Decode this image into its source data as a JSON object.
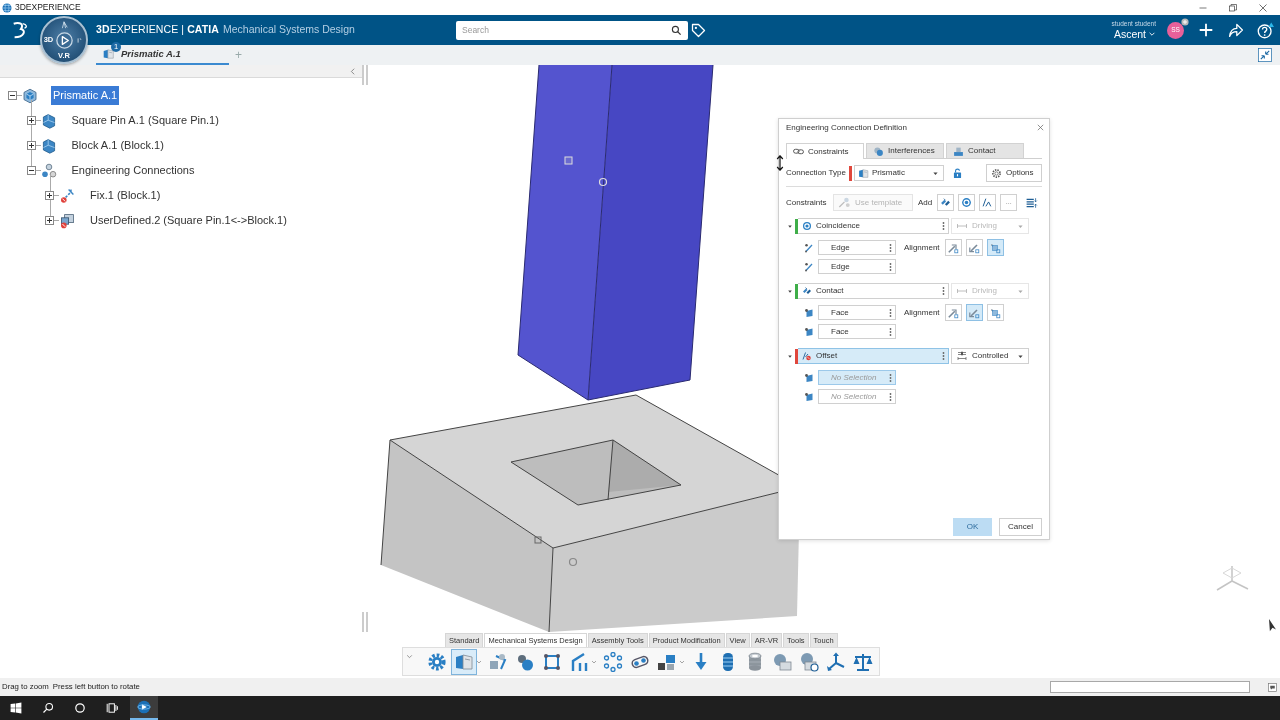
{
  "window": {
    "title": "3DEXPERIENCE"
  },
  "header": {
    "brand": "**3D**EXPERIENCE | **CATIA**",
    "app_name": "Mechanical Systems Design",
    "compass": {
      "left_label": "3D",
      "bottom_label": "V.R"
    },
    "search": {
      "placeholder": "Search"
    },
    "user": {
      "name": "student student",
      "tenant": "Ascent",
      "initials": "SS"
    }
  },
  "tabs": [
    {
      "label": "Prismatic A.1",
      "badge": "1",
      "selected": true
    }
  ],
  "new_tab": "+",
  "tree": [
    {
      "label": "Prismatic A.1",
      "kind": "product",
      "selected": true,
      "expanded": true,
      "children": [
        {
          "label": "Square Pin A.1 (Square Pin.1)",
          "kind": "part",
          "selected": false,
          "expanded": false
        },
        {
          "label": "Block A.1 (Block.1)",
          "kind": "part",
          "selected": false,
          "expanded": false
        },
        {
          "label": "Engineering Connections",
          "kind": "connections",
          "selected": false,
          "expanded": true,
          "children": [
            {
              "label": "Fix.1 (Block.1)",
              "kind": "fix",
              "selected": false,
              "expanded": false
            },
            {
              "label": "UserDefined.2 (Square Pin.1<->Block.1)",
              "kind": "user_defined",
              "selected": false,
              "expanded": false
            }
          ]
        }
      ]
    }
  ],
  "dialog": {
    "title": "Engineering Connection Definition",
    "tabs": [
      {
        "label": "Constraints",
        "kind": "constraints",
        "selected": true
      },
      {
        "label": "Interferences",
        "kind": "interferences",
        "selected": false
      },
      {
        "label": "Contact",
        "kind": "contact",
        "selected": false
      }
    ],
    "connection_type": {
      "label": "Connection Type",
      "value": "Prismatic",
      "color": "#e0473c"
    },
    "options": "Options",
    "constraints_label": "Constraints",
    "use_template": {
      "label": "Use template",
      "disabled": true
    },
    "add_label": "Add",
    "more": "...",
    "constraints": [
      {
        "name": "Coincidence",
        "kind": "coincidence",
        "color": "#3fae49",
        "selected": false,
        "expanded": true,
        "mode": {
          "label": "Driving",
          "kind": "driving",
          "disabled": true
        },
        "elements": [
          {
            "value": "Edge",
            "kind": "edge",
            "selected": false
          },
          {
            "value": "Edge",
            "kind": "edge",
            "selected": false
          }
        ],
        "alignment": {
          "label": "Alignment",
          "options": [
            {
              "kind": "same",
              "selected": false
            },
            {
              "kind": "opposite",
              "selected": false
            },
            {
              "kind": "any",
              "selected": true
            }
          ]
        }
      },
      {
        "name": "Contact",
        "kind": "contact",
        "color": "#3fae49",
        "selected": false,
        "expanded": true,
        "mode": {
          "label": "Driving",
          "kind": "driving",
          "disabled": true
        },
        "elements": [
          {
            "value": "Face",
            "kind": "face",
            "selected": false
          },
          {
            "value": "Face",
            "kind": "face",
            "selected": false
          }
        ],
        "alignment": {
          "label": "Alignment",
          "options": [
            {
              "kind": "same",
              "selected": false
            },
            {
              "kind": "opposite",
              "selected": true
            },
            {
              "kind": "any",
              "selected": false
            }
          ]
        }
      },
      {
        "name": "Offset",
        "kind": "offset",
        "color": "#e0473c",
        "selected": true,
        "expanded": true,
        "mode": {
          "label": "Controlled",
          "kind": "controlled",
          "disabled": false
        },
        "elements": [
          {
            "placeholder": "No Selection",
            "kind": "face",
            "selected": true
          },
          {
            "placeholder": "No Selection",
            "kind": "face",
            "selected": false
          }
        ]
      }
    ],
    "buttons": [
      {
        "label": "OK",
        "disabled": true
      },
      {
        "label": "Cancel",
        "disabled": false
      }
    ]
  },
  "toolbar": {
    "tabs": [
      {
        "label": "Standard",
        "selected": false
      },
      {
        "label": "Mechanical Systems Design",
        "selected": true
      },
      {
        "label": "Assembly Tools",
        "selected": false
      },
      {
        "label": "Product Modification",
        "selected": false
      },
      {
        "label": "View",
        "selected": false
      },
      {
        "label": "AR-VR",
        "selected": false
      },
      {
        "label": "Tools",
        "selected": false
      },
      {
        "label": "Touch",
        "selected": false
      }
    ],
    "tools": [
      {
        "kind": "settings",
        "selected": false,
        "menu": false
      },
      {
        "kind": "prismatic",
        "selected": true,
        "menu": true
      },
      {
        "kind": "mechanism",
        "selected": false,
        "menu": false
      },
      {
        "kind": "spheres",
        "selected": false,
        "menu": false
      },
      {
        "kind": "frame",
        "selected": false,
        "menu": false
      },
      {
        "kind": "joint",
        "selected": false,
        "menu": true
      },
      {
        "kind": "network",
        "selected": false,
        "menu": false
      },
      {
        "kind": "belt",
        "selected": false,
        "menu": false
      },
      {
        "kind": "cubes",
        "selected": false,
        "menu": true
      },
      {
        "kind": "load",
        "selected": false,
        "menu": false
      },
      {
        "kind": "spring",
        "selected": false,
        "menu": false
      },
      {
        "kind": "bushing",
        "selected": false,
        "menu": false
      },
      {
        "kind": "sensor",
        "selected": false,
        "menu": false
      },
      {
        "kind": "sensor_clock",
        "selected": false,
        "menu": false
      },
      {
        "kind": "axes",
        "selected": false,
        "menu": false
      },
      {
        "kind": "balance",
        "selected": false,
        "menu": false
      }
    ]
  },
  "status_bar": {
    "messages": [
      "Drag to zoom",
      "Press left button to rotate"
    ]
  },
  "taskbar": {
    "items": [
      {
        "kind": "start",
        "selected": false
      },
      {
        "kind": "search",
        "selected": false
      },
      {
        "kind": "cortana",
        "selected": false
      },
      {
        "kind": "task_view",
        "selected": false
      },
      {
        "kind": "app",
        "selected": true
      }
    ]
  }
}
